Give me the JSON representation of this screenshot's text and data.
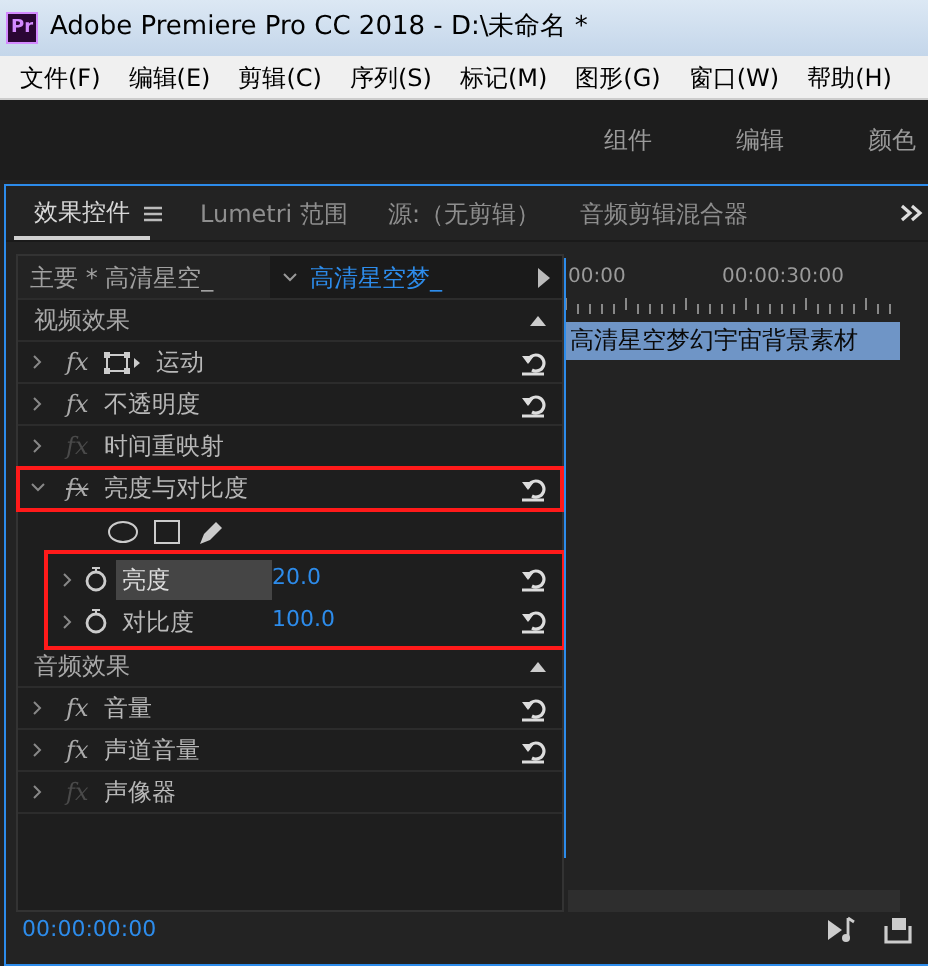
{
  "window": {
    "app_icon": "Pr",
    "title": "Adobe Premiere Pro CC 2018 - D:\\未命名 *"
  },
  "menu": [
    "文件(F)",
    "编辑(E)",
    "剪辑(C)",
    "序列(S)",
    "标记(M)",
    "图形(G)",
    "窗口(W)",
    "帮助(H)"
  ],
  "workspaces": [
    "组件",
    "编辑",
    "颜色"
  ],
  "tabs": [
    {
      "label": "效果控件",
      "selected": true
    },
    {
      "label": "Lumetri 范围",
      "selected": false
    },
    {
      "label": "源:（无剪辑）",
      "selected": false
    },
    {
      "label": "音频剪辑混合器",
      "selected": false
    }
  ],
  "clip_header": {
    "master": "主要 * 高清星空_",
    "clip": "高清星空梦_"
  },
  "effects": [
    {
      "kind": "section",
      "label": "视频效果"
    },
    {
      "kind": "effect",
      "label": "运动",
      "fx": "fx",
      "fx_enabled": true,
      "bypassed": false,
      "motion_icon": true,
      "reset": true,
      "highlighted": false
    },
    {
      "kind": "effect",
      "label": "不透明度",
      "fx": "fx",
      "fx_enabled": true,
      "bypassed": false,
      "reset": true,
      "highlighted": false
    },
    {
      "kind": "effect",
      "label": "时间重映射",
      "fx": "fx",
      "fx_enabled": false,
      "bypassed": false,
      "reset": false,
      "highlighted": false
    },
    {
      "kind": "effect",
      "label": "亮度与对比度",
      "fx": "fx",
      "fx_enabled": true,
      "bypassed": true,
      "expanded": true,
      "reset": true,
      "highlighted": true
    },
    {
      "kind": "masks"
    },
    {
      "kind": "params",
      "highlighted": true,
      "children": [
        {
          "label": "亮度",
          "value": "20.0",
          "selected": true,
          "reset": true
        },
        {
          "label": "对比度",
          "value": "100.0",
          "selected": false,
          "reset": true
        }
      ]
    },
    {
      "kind": "section",
      "label": "音频效果"
    },
    {
      "kind": "effect",
      "label": "音量",
      "fx": "fx",
      "fx_enabled": true,
      "bypassed": false,
      "reset": true,
      "highlighted": false
    },
    {
      "kind": "effect",
      "label": "声道音量",
      "fx": "fx",
      "fx_enabled": true,
      "bypassed": false,
      "reset": true,
      "highlighted": false
    },
    {
      "kind": "effect",
      "label": "声像器",
      "fx": "fx",
      "fx_enabled": false,
      "bypassed": false,
      "reset": false,
      "highlighted": false
    }
  ],
  "timeline": {
    "ticks": [
      "00:00",
      "00:00:30:00"
    ],
    "clip": "高清星空梦幻宇宙背景素材"
  },
  "status_bar": {
    "timecode": "00:00:00:00"
  }
}
